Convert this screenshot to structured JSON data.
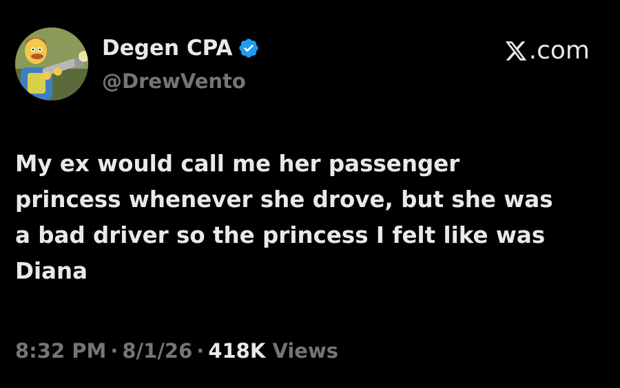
{
  "author": {
    "name": "Degen CPA",
    "handle": "@DrewVento",
    "avatar_icon": "cartoon-man-with-leaf-blower-avatar",
    "verified_icon": "verified-badge-icon",
    "verified_color": "#1d9bf0"
  },
  "brand": {
    "logo_icon": "x-logo-icon",
    "suffix": ".com"
  },
  "tweet": {
    "text": "My ex would call me her passenger\nprincess whenever she drove, but she was\na bad driver so the princess I felt like was\nDiana"
  },
  "meta": {
    "time": "8:32 PM",
    "date": "8/1/26",
    "views_count": "418K",
    "views_label": "Views",
    "separator": "·"
  },
  "colors": {
    "background": "#000000",
    "primary_text": "#e7e9ea",
    "secondary_text": "#71767b"
  }
}
